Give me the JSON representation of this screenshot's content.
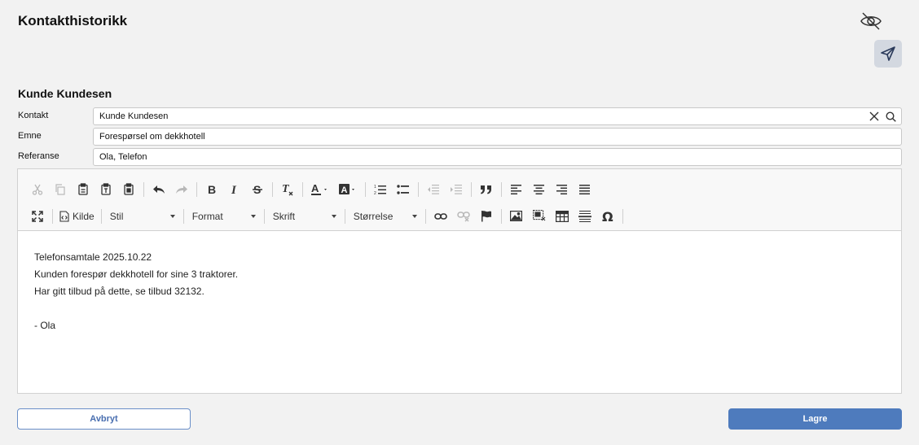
{
  "page_title": "Kontakthistorikk",
  "customer_heading": "Kunde Kundesen",
  "fields": [
    {
      "label": "Kontakt",
      "value": "Kunde Kundesen"
    },
    {
      "label": "Emne",
      "value": "Forespørsel om dekkhotell"
    },
    {
      "label": "Referanse",
      "value": "Ola, Telefon"
    }
  ],
  "toolbar": {
    "source_label": "Kilde",
    "style_label": "Stil",
    "format_label": "Format",
    "font_label": "Skrift",
    "size_label": "Størrelse"
  },
  "content_lines": [
    "Telefonsamtale 2025.10.22",
    "Kunden forespør dekkhotell for sine 3 traktorer.",
    "Har gitt tilbud på dette, se tilbud 32132.",
    "",
    "- Ola"
  ],
  "buttons": {
    "cancel": "Avbryt",
    "save": "Lagre"
  },
  "colors": {
    "accent": "#4e7bbd",
    "background": "#f2f2f2"
  },
  "icons": [
    "eye-off-icon",
    "send-icon",
    "clear-icon",
    "search-icon"
  ]
}
